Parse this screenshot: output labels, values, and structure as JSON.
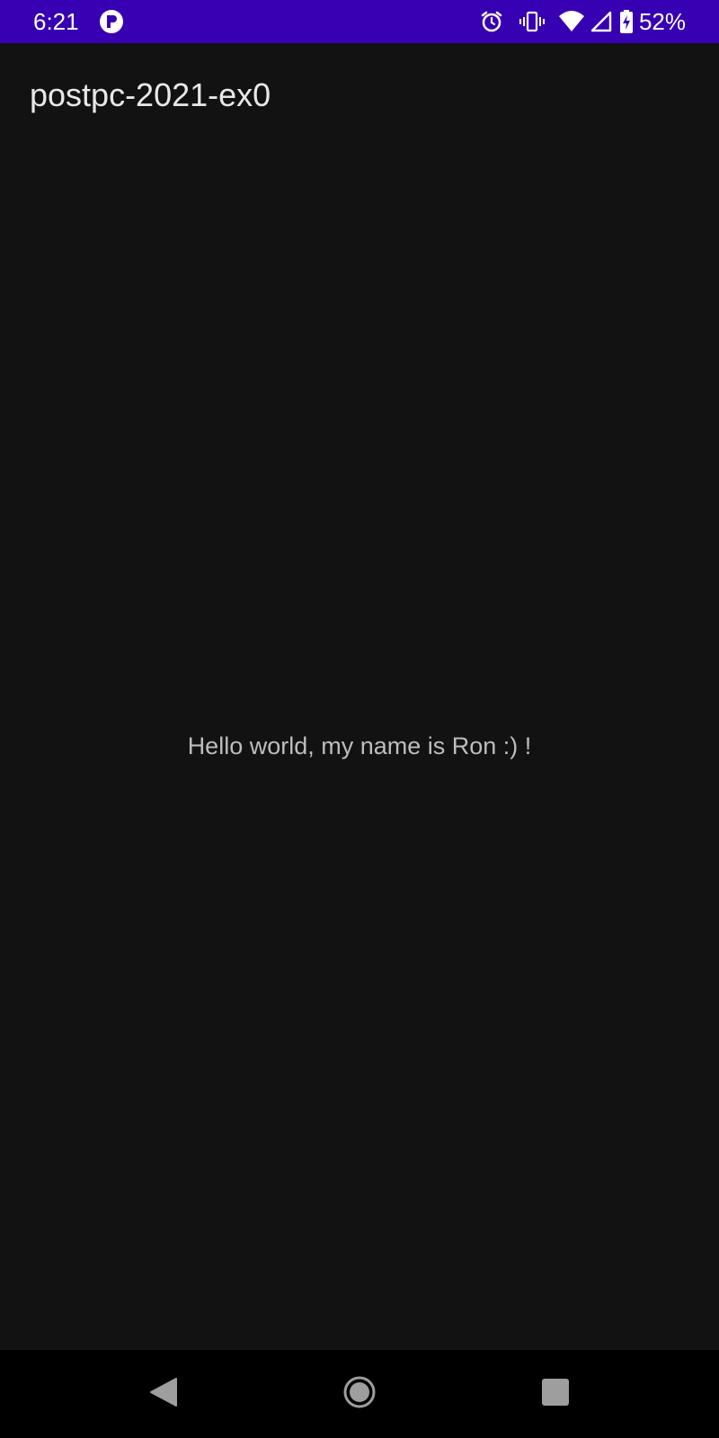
{
  "status_bar": {
    "time": "6:21",
    "battery_percent": "52%",
    "icons": [
      "app-notification-icon",
      "alarm-icon",
      "vibrate-icon",
      "wifi-icon",
      "cell-signal-icon",
      "battery-charging-icon"
    ]
  },
  "app_bar": {
    "title": "postpc-2021-ex0"
  },
  "main": {
    "greeting": "Hello world, my name is Ron :) !"
  },
  "nav_bar": {
    "buttons": [
      "back-icon",
      "home-icon",
      "recents-icon"
    ]
  },
  "colors": {
    "status_bar": "#3700B3",
    "background": "#121212",
    "nav_bar": "#000000",
    "title_text": "#E8E8E8",
    "body_text": "#BDBDBD"
  }
}
